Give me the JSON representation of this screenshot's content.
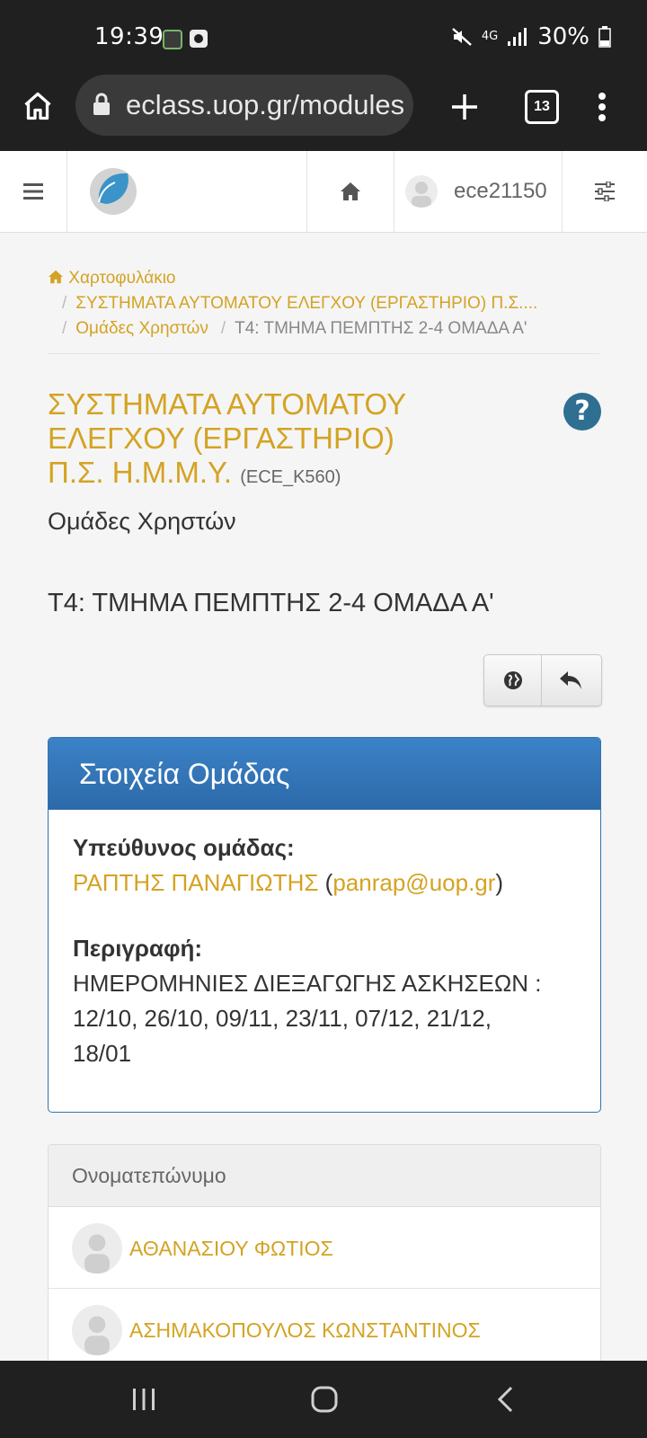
{
  "status_bar": {
    "time": "19:39",
    "network": "4G",
    "battery": "30%"
  },
  "browser": {
    "url": "eclass.uop.gr/modules",
    "tab_count": "13"
  },
  "navbar": {
    "username": "ece21150"
  },
  "breadcrumb": {
    "home": "Χαρτοφυλάκιο",
    "course": "ΣΥΣΤΗΜΑΤΑ ΑΥΤΟΜΑΤΟΥ ΕΛΕΓΧΟΥ (ΕΡΓΑΣΤΗΡΙΟ) Π.Σ....",
    "module": "Ομάδες Χρηστών",
    "current": "Τ4: ΤΜΗΜΑ ΠΕΜΠΤΗΣ 2-4 ΟΜΑΔΑ Α'",
    "separator": "/"
  },
  "course": {
    "title_line1": "ΣΥΣΤΗΜΑΤΑ ΑΥΤΟΜΑΤΟΥ",
    "title_line2": "ΕΛΕΓΧΟΥ (ΕΡΓΑΣΤΗΡΙΟ)",
    "title_line3": "Π.Σ. Η.Μ.Μ.Υ.",
    "code": "(ECE_K560)",
    "module_title": "Ομάδες Χρηστών",
    "help": "?"
  },
  "group": {
    "name": "Τ4: ΤΜΗΜΑ ΠΕΜΠΤΗΣ 2-4 ΟΜΑΔΑ Α'"
  },
  "panel": {
    "header": "Στοιχεία Ομάδας",
    "leader_label": "Υπεύθυνος ομάδας:",
    "leader_name": "ΡΑΠΤΗΣ ΠΑΝΑΓΙΩΤΗΣ",
    "leader_email": "panrap@uop.gr",
    "open_paren": "(",
    "close_paren": ")",
    "description_label": "Περιγραφή:",
    "description_line1": "ΗΜΕΡΟΜΗΝΙΕΣ ΔΙΕΞΑΓΩΓΗΣ ΑΣΚΗΣΕΩΝ :",
    "description_line2": "12/10, 26/10, 09/11, 23/11, 07/12, 21/12,",
    "description_line3": "18/01"
  },
  "members": {
    "header": "Ονοματεπώνυμο",
    "rows": [
      {
        "name": "ΑΘΑΝΑΣΙΟΥ ΦΩΤΙΟΣ"
      },
      {
        "name": "ΑΣΗΜΑΚΟΠΟΥΛΟΣ ΚΩΝΣΤΑΝΤΙΝΟΣ"
      }
    ]
  },
  "colors": {
    "accent": "#d4a323",
    "panel_blue": "#2f6fae",
    "help_blue": "#2f6f91"
  }
}
